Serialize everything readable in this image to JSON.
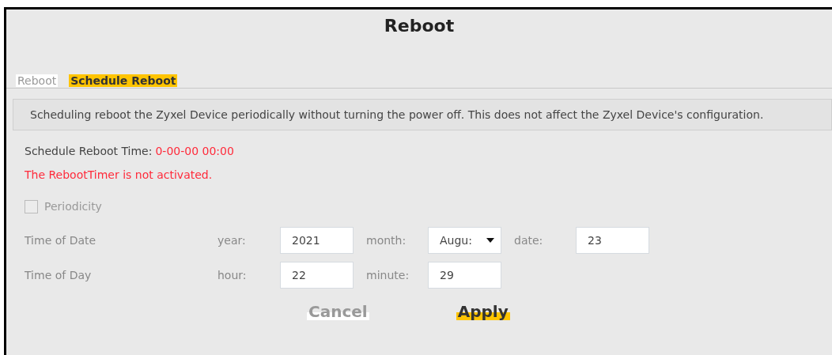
{
  "title": "Reboot",
  "tabs": [
    {
      "label": "Reboot",
      "selected": false
    },
    {
      "label": "Schedule Reboot",
      "selected": true
    }
  ],
  "description": "Scheduling reboot the Zyxel Device periodically without turning the power off. This does not affect the Zyxel Device's configuration.",
  "schedule_time": {
    "label": "Schedule Reboot Time:",
    "value": "0-00-00 00:00"
  },
  "status_message": "The RebootTimer is not activated.",
  "periodicity": {
    "label": "Periodicity",
    "checked": false,
    "disabled": true
  },
  "rows": [
    {
      "label": "Time of Date",
      "fields": [
        {
          "label": "year:",
          "value": "2021",
          "kind": "input"
        },
        {
          "label": "month:",
          "value": "Augu:",
          "kind": "select"
        },
        {
          "label": "date:",
          "value": "23",
          "kind": "input"
        }
      ]
    },
    {
      "label": "Time of Day",
      "fields": [
        {
          "label": "hour:",
          "value": "22",
          "kind": "input"
        },
        {
          "label": "minute:",
          "value": "29",
          "kind": "input"
        }
      ]
    }
  ],
  "buttons": [
    {
      "label": "Cancel",
      "kind": "secondary"
    },
    {
      "label": "Apply",
      "kind": "primary"
    }
  ]
}
